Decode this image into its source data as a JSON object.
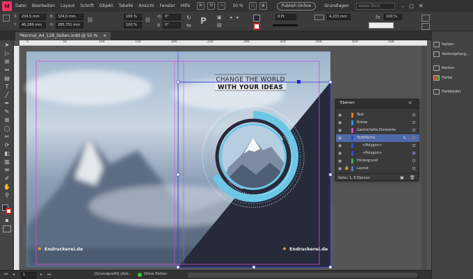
{
  "app": {
    "logo": "Id"
  },
  "menu": [
    "Datei",
    "Bearbeiten",
    "Layout",
    "Schrift",
    "Objekt",
    "Tabelle",
    "Ansicht",
    "Fenster",
    "Hilfe"
  ],
  "menubar_right": {
    "zoom": "50 %",
    "publish_label": "Publish Online",
    "workspace": "Grundlagen",
    "search_placeholder": "Adobe Stock"
  },
  "control": {
    "x_label": "X:",
    "x_value": "234,5 mm",
    "y_label": "Y:",
    "y_value": "46,289 mm",
    "w_label": "B:",
    "w_value": "324,5 mm",
    "h_label": "H:",
    "h_value": "285,751 mm",
    "scale_x": "100 %",
    "scale_y": "100 %",
    "rotate": "0°",
    "shear": "0°",
    "stroke_weight": "0 Pt",
    "ref_value": "4,233 mm",
    "opacity": "100 %"
  },
  "document_tab": {
    "title": "*Normal_A4_128_Seiten.indd @ 50 %",
    "close": "×"
  },
  "ruler_marks": [
    "0",
    "50",
    "100",
    "150",
    "200",
    "250",
    "300",
    "350",
    "400",
    "450",
    "500"
  ],
  "artwork": {
    "headline1": "CHANGE THE WORLD",
    "headline2": "WITH YOUR IDEAS",
    "brand": "Endruckerei.de",
    "brand_left": "Endruckerei.de"
  },
  "layers_panel": {
    "tab": "Ebenen",
    "layers": [
      {
        "name": "Text",
        "color": "#e8742a"
      },
      {
        "name": "Kreise",
        "color": "#2f8cff"
      },
      {
        "name": "Gestrichelte Elemente",
        "color": "#d04cd6"
      },
      {
        "name": "Farbfläche",
        "color": "#2f4fd8",
        "selected": true
      },
      {
        "name": "<Polygon>",
        "color": "#2f4fd8",
        "sub": true
      },
      {
        "name": "<Polygon>",
        "color": "#2f4fd8",
        "sub": true
      },
      {
        "name": "Hintergrund",
        "color": "#39b54a"
      },
      {
        "name": "Layout",
        "color": "#4a7bd8"
      }
    ],
    "footer": "Seite: 1, 8 Ebenen"
  },
  "right_panels": [
    "Seiten",
    "Verknüpfung...",
    "Kontur",
    "Farbe",
    "Farbfelder"
  ],
  "status": {
    "page": "1",
    "master": "[Grundprofil] (Arb...",
    "preflight": "Ohne Fehler"
  },
  "colors": {
    "accent_dark": "#262a3b",
    "accent_cyan": "#6cc7e6",
    "selection": "#3a3ad8",
    "margin": "#d14ed6"
  }
}
